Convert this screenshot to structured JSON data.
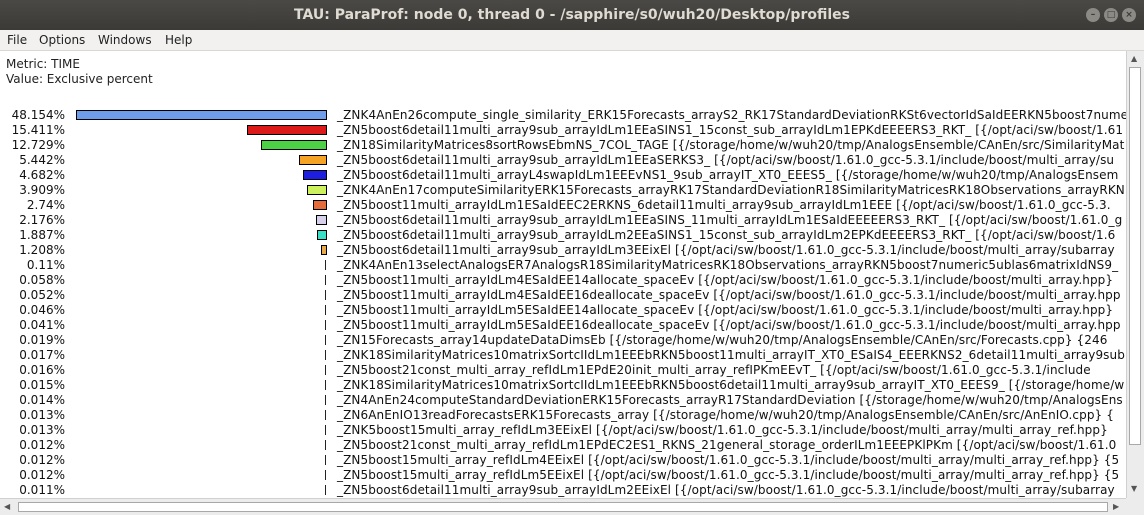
{
  "window": {
    "title": "TAU: ParaProf: node 0, thread 0 - /sapphire/s0/wuh20/Desktop/profiles"
  },
  "menu": [
    "File",
    "Options",
    "Windows",
    "Help"
  ],
  "info": {
    "metric": "Metric: TIME",
    "value": "Value: Exclusive percent"
  },
  "profile": {
    "max_percent": 48.154,
    "rows": [
      {
        "percent_label": "48.154%",
        "percent": 48.154,
        "color": "#6f9dea",
        "name": "_ZNK4AnEn26compute_single_similarity_ERK15Forecasts_arrayS2_RK17StandardDeviationRKSt6vectorIdSaIdEERKN5boost7nume"
      },
      {
        "percent_label": "15.411%",
        "percent": 15.411,
        "color": "#dd1a1a",
        "name": "_ZN5boost6detail11multi_array9sub_arrayIdLm1EEaSINS1_15const_sub_arrayIdLm1EPKdEEEERS3_RKT_ [{/opt/aci/sw/boost/1.61"
      },
      {
        "percent_label": "12.729%",
        "percent": 12.729,
        "color": "#4cd146",
        "name": "_ZN18SimilarityMatrices8sortRowsEbmNS_7COL_TAGE [{/storage/home/w/wuh20/tmp/AnalogsEnsemble/CAnEn/src/SimilarityMat"
      },
      {
        "percent_label": "5.442%",
        "percent": 5.442,
        "color": "#f5a324",
        "name": "_ZN5boost6detail11multi_array9sub_arrayIdLm1EEaSERKS3_ [{/opt/aci/sw/boost/1.61.0_gcc-5.3.1/include/boost/multi_array/su"
      },
      {
        "percent_label": "4.682%",
        "percent": 4.682,
        "color": "#1d1ee0",
        "name": "_ZN5boost6detail11multi_arrayL4swapIdLm1EEEvNS1_9sub_arrayIT_XT0_EEES5_ [{/storage/home/w/wuh20/tmp/AnalogsEnsem"
      },
      {
        "percent_label": "3.909%",
        "percent": 3.909,
        "color": "#cdf05d",
        "name": "_ZNK4AnEn17computeSimilarityERK15Forecasts_arrayRK17StandardDeviationR18SimilarityMatricesRK18Observations_arrayRKN"
      },
      {
        "percent_label": "2.74%",
        "percent": 2.74,
        "color": "#e46b3a",
        "name": "_ZN5boost11multi_arrayIdLm1ESaIdEEC2ERKNS_6detail11multi_array9sub_arrayIdLm1EEE [{/opt/aci/sw/boost/1.61.0_gcc-5.3."
      },
      {
        "percent_label": "2.176%",
        "percent": 2.176,
        "color": "#d7d0ea",
        "name": "_ZN5boost6detail11multi_array9sub_arrayIdLm1EEaSINS_11multi_arrayIdLm1ESaIdEEEEERS3_RKT_ [{/opt/aci/sw/boost/1.61.0_g"
      },
      {
        "percent_label": "1.887%",
        "percent": 1.887,
        "color": "#39dfc4",
        "name": "_ZN5boost6detail11multi_array9sub_arrayIdLm2EEaSINS1_15const_sub_arrayIdLm2EPKdEEEERS3_RKT_ [{/opt/aci/sw/boost/1.6"
      },
      {
        "percent_label": "1.208%",
        "percent": 1.208,
        "color": "#e8a94a",
        "name": "_ZN5boost6detail11multi_array9sub_arrayIdLm3EEixEl [{/opt/aci/sw/boost/1.61.0_gcc-5.3.1/include/boost/multi_array/subarray"
      },
      {
        "percent_label": "0.11%",
        "percent": 0.11,
        "color": "#999999",
        "name": "_ZNK4AnEn13selectAnalogsER7AnalogsR18SimilarityMatricesRK18Observations_arrayRKN5boost7numeric5ublas6matrixIdNS9_"
      },
      {
        "percent_label": "0.058%",
        "percent": 0.058,
        "color": "#999999",
        "name": "_ZN5boost11multi_arrayIdLm4ESaIdEE14allocate_spaceEv [{/opt/aci/sw/boost/1.61.0_gcc-5.3.1/include/boost/multi_array.hpp}"
      },
      {
        "percent_label": "0.052%",
        "percent": 0.052,
        "color": "#999999",
        "name": "_ZN5boost11multi_arrayIdLm4ESaIdEE16deallocate_spaceEv [{/opt/aci/sw/boost/1.61.0_gcc-5.3.1/include/boost/multi_array.hpp"
      },
      {
        "percent_label": "0.046%",
        "percent": 0.046,
        "color": "#999999",
        "name": "_ZN5boost11multi_arrayIdLm5ESaIdEE14allocate_spaceEv [{/opt/aci/sw/boost/1.61.0_gcc-5.3.1/include/boost/multi_array.hpp}"
      },
      {
        "percent_label": "0.041%",
        "percent": 0.041,
        "color": "#999999",
        "name": "_ZN5boost11multi_arrayIdLm5ESaIdEE16deallocate_spaceEv [{/opt/aci/sw/boost/1.61.0_gcc-5.3.1/include/boost/multi_array.hpp"
      },
      {
        "percent_label": "0.019%",
        "percent": 0.019,
        "color": "#999999",
        "name": "_ZN15Forecasts_array14updateDataDimsEb [{/storage/home/w/wuh20/tmp/AnalogsEnsemble/CAnEn/src/Forecasts.cpp} {246"
      },
      {
        "percent_label": "0.017%",
        "percent": 0.017,
        "color": "#999999",
        "name": "_ZNK18SimilarityMatrices10matrixSortcIIdLm1EEEbRKN5boost11multi_arrayIT_XT0_ESaIS4_EEERKNS2_6detail11multi_array9sub"
      },
      {
        "percent_label": "0.016%",
        "percent": 0.016,
        "color": "#999999",
        "name": "_ZN5boost21const_multi_array_refIdLm1EPdE20init_multi_array_refIPKmEEvT_ [{/opt/aci/sw/boost/1.61.0_gcc-5.3.1/include"
      },
      {
        "percent_label": "0.015%",
        "percent": 0.015,
        "color": "#999999",
        "name": "_ZNK18SimilarityMatrices10matrixSortcIIdLm1EEEbRKN5boost6detail11multi_array9sub_arrayIT_XT0_EEES9_ [{/storage/home/w"
      },
      {
        "percent_label": "0.014%",
        "percent": 0.014,
        "color": "#999999",
        "name": "_ZN4AnEn24computeStandardDeviationERK15Forecasts_arrayR17StandardDeviation [{/storage/home/w/wuh20/tmp/AnalogsEns"
      },
      {
        "percent_label": "0.013%",
        "percent": 0.013,
        "color": "#999999",
        "name": "_ZN6AnEnIO13readForecastsERK15Forecasts_array [{/storage/home/w/wuh20/tmp/AnalogsEnsemble/CAnEn/src/AnEnIO.cpp} {"
      },
      {
        "percent_label": "0.013%",
        "percent": 0.013,
        "color": "#999999",
        "name": "_ZNK5boost15multi_array_refIdLm3EEixEl [{/opt/aci/sw/boost/1.61.0_gcc-5.3.1/include/boost/multi_array/multi_array_ref.hpp}"
      },
      {
        "percent_label": "0.012%",
        "percent": 0.012,
        "color": "#999999",
        "name": "_ZN5boost21const_multi_array_refIdLm1EPdEC2ES1_RKNS_21general_storage_orderILm1EEEPKlPKm [{/opt/aci/sw/boost/1.61.0"
      },
      {
        "percent_label": "0.012%",
        "percent": 0.012,
        "color": "#999999",
        "name": "_ZN5boost15multi_array_refIdLm4EEixEl [{/opt/aci/sw/boost/1.61.0_gcc-5.3.1/include/boost/multi_array/multi_array_ref.hpp} {5"
      },
      {
        "percent_label": "0.012%",
        "percent": 0.012,
        "color": "#999999",
        "name": "_ZN5boost15multi_array_refIdLm5EEixEl [{/opt/aci/sw/boost/1.61.0_gcc-5.3.1/include/boost/multi_array/multi_array_ref.hpp} {5"
      },
      {
        "percent_label": "0.011%",
        "percent": 0.011,
        "color": "#999999",
        "name": "_ZN5boost6detail11multi_array9sub_arrayIdLm2EEixEl [{/opt/aci/sw/boost/1.61.0_gcc-5.3.1/include/boost/multi_array/subarray"
      }
    ]
  }
}
